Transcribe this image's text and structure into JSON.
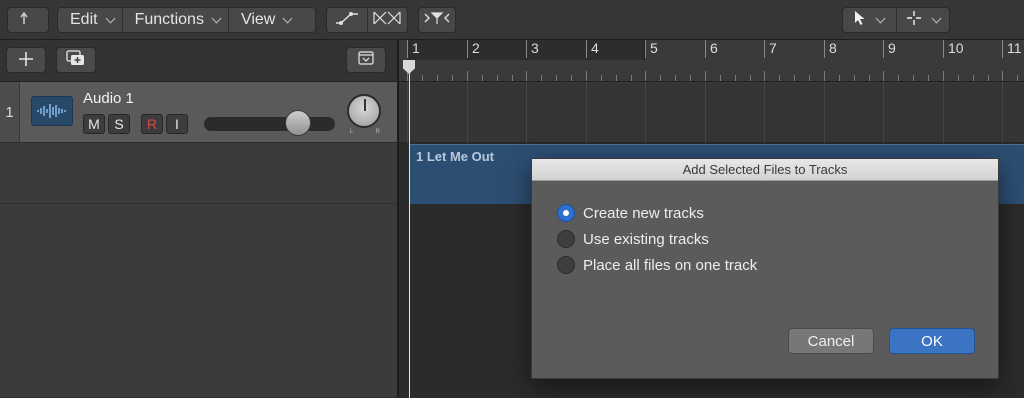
{
  "toolbar": {
    "back_icon": "back-arrow-icon",
    "menus": [
      {
        "label": "Edit"
      },
      {
        "label": "Functions"
      },
      {
        "label": "View"
      }
    ],
    "automation_icons": [
      "automation-curve-icon",
      "flex-time-icon"
    ],
    "catch_icon": "catch-playhead-icon",
    "tools": [
      "pointer-tool-icon",
      "marquee-tool-icon"
    ]
  },
  "track_panel": {
    "add_track_icon": "plus-icon",
    "duplicate_track_icon": "duplicate-track-icon",
    "collapse_icon": "collapse-icon"
  },
  "track": {
    "number": "1",
    "name": "Audio 1",
    "icon": "audio-waveform-icon",
    "mute_label": "M",
    "solo_label": "S",
    "record_label": "R",
    "input_label": "I",
    "volume_fraction": 0.72,
    "pan_left": "L",
    "pan_right": "R"
  },
  "ruler": {
    "bars": [
      "1",
      "2",
      "3",
      "4",
      "5",
      "6",
      "7",
      "8",
      "9",
      "10",
      "11"
    ]
  },
  "region": {
    "label": "1 Let Me Out",
    "color": "#2d4e73"
  },
  "dialog": {
    "title": "Add Selected Files to Tracks",
    "options": [
      {
        "label": "Create new tracks",
        "selected": true
      },
      {
        "label": "Use existing tracks",
        "selected": false
      },
      {
        "label": "Place all files on one track",
        "selected": false
      }
    ],
    "cancel_label": "Cancel",
    "ok_label": "OK",
    "accent": "#3a74c2"
  }
}
